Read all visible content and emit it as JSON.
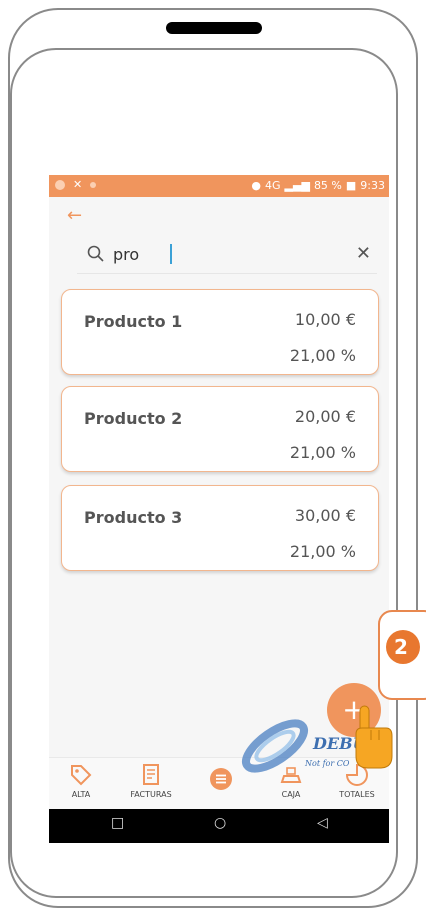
{
  "status_bar": {
    "network": "4G",
    "battery": "85 %",
    "time": "9:33"
  },
  "search": {
    "value": "pro",
    "placeholder": ""
  },
  "products": [
    {
      "name": "Producto 1",
      "price": "10,00 €",
      "vat": "21,00 %"
    },
    {
      "name": "Producto 2",
      "price": "20,00 €",
      "vat": "21,00 %"
    },
    {
      "name": "Producto 3",
      "price": "30,00 €",
      "vat": "21,00 %"
    }
  ],
  "fab": {
    "label": "+"
  },
  "bottom_nav": {
    "alta": "ALTA",
    "facturas": "FACTURAS",
    "caja": "CAJA",
    "totales": "TOTALES"
  },
  "callout": {
    "step": "2"
  },
  "watermark": {
    "text": "DEBU",
    "subtext": "Not for CO"
  },
  "colors": {
    "accent": "#f0955d",
    "card_border": "#f2b68e",
    "text": "#555555"
  },
  "icons": [
    "back-arrow-icon",
    "search-icon",
    "close-icon",
    "tag-icon",
    "invoice-icon",
    "menu-icon",
    "register-icon",
    "chart-icon",
    "plus-icon"
  ]
}
